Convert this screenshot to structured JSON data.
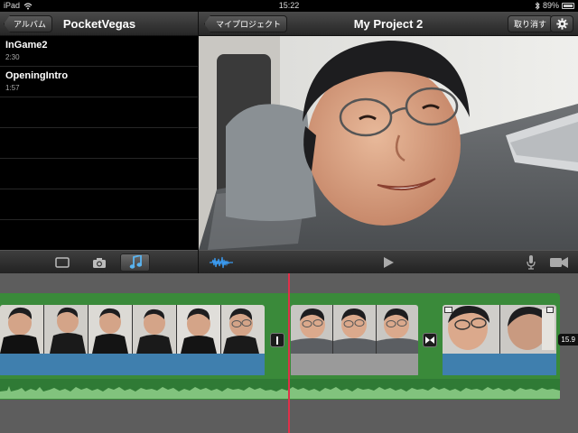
{
  "status": {
    "device": "iPad",
    "time": "15:22",
    "battery": "89%"
  },
  "left_panel": {
    "back_label": "アルバム",
    "title": "PocketVegas"
  },
  "media": [
    {
      "name": "InGame2",
      "duration": "2:30"
    },
    {
      "name": "OpeningIntro",
      "duration": "1:57"
    }
  ],
  "project": {
    "back_label": "マイプロジェクト",
    "title": "My Project 2",
    "undo_label": "取り消す"
  },
  "media_tabs": [
    {
      "icon": "video-icon",
      "active": false
    },
    {
      "icon": "camera-icon",
      "active": false
    },
    {
      "icon": "music-note-icon",
      "active": true
    }
  ],
  "viewer_controls": [
    "audio-waveform-icon",
    "play-icon",
    "microphone-icon",
    "video-camera-icon"
  ],
  "timeline": {
    "timecode": "15.9"
  },
  "colors": {
    "track_green": "#3a8a3a",
    "clip_band_blue": "#3f7fae",
    "playhead": "#e0304a",
    "active_tab_icon": "#5ab4f0"
  }
}
